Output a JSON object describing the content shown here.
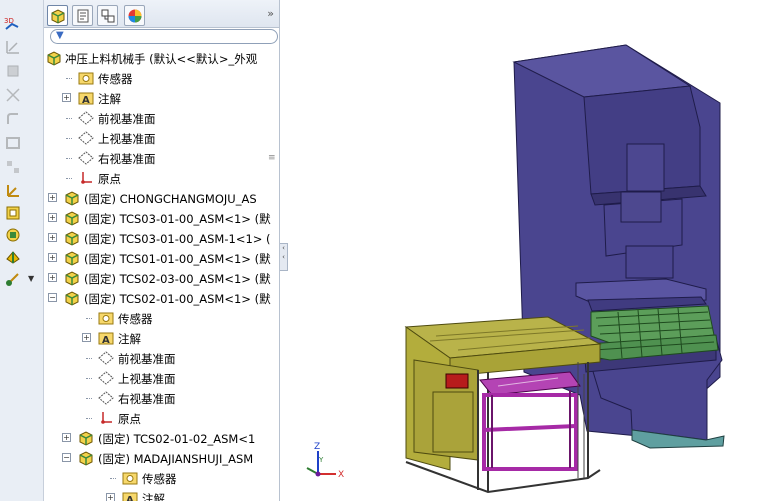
{
  "tree": {
    "root_label": "冲压上料机械手  (默认<<默认>_外观",
    "items": [
      {
        "label": "传感器",
        "icon": "sensor-folder-icon"
      },
      {
        "label": "注解",
        "icon": "annotation-folder-icon"
      },
      {
        "label": "前视基准面",
        "icon": "plane-icon"
      },
      {
        "label": "上视基准面",
        "icon": "plane-icon"
      },
      {
        "label": "右视基准面",
        "icon": "plane-icon"
      },
      {
        "label": "原点",
        "icon": "origin-icon"
      },
      {
        "label": "(固定) CHONGCHANGMOJU_AS",
        "icon": "assembly-icon"
      },
      {
        "label": "(固定) TCS03-01-00_ASM<1> (默",
        "icon": "assembly-icon"
      },
      {
        "label": "(固定) TCS03-01-00_ASM-1<1> (",
        "icon": "assembly-icon"
      },
      {
        "label": "(固定) TCS01-01-00_ASM<1> (默",
        "icon": "assembly-icon"
      },
      {
        "label": "(固定) TCS02-03-00_ASM<1> (默",
        "icon": "assembly-icon"
      },
      {
        "label": "(固定) TCS02-01-00_ASM<1> (默",
        "icon": "assembly-icon"
      },
      {
        "label": "传感器",
        "icon": "sensor-folder-icon"
      },
      {
        "label": "注解",
        "icon": "annotation-folder-icon"
      },
      {
        "label": "前视基准面",
        "icon": "plane-icon"
      },
      {
        "label": "上视基准面",
        "icon": "plane-icon"
      },
      {
        "label": "右视基准面",
        "icon": "plane-icon"
      },
      {
        "label": "原点",
        "icon": "origin-icon"
      },
      {
        "label": "(固定) TCS02-01-02_ASM<1",
        "icon": "assembly-icon"
      },
      {
        "label": "(固定) MADAJIANSHUJI_ASM",
        "icon": "assembly-icon"
      },
      {
        "label": "传感器",
        "icon": "sensor-folder-icon"
      },
      {
        "label": "注解",
        "icon": "annotation-folder-icon"
      }
    ],
    "more_glyph": "»"
  },
  "triad": {
    "x": "X",
    "y": "Y",
    "z": "Z"
  },
  "colors": {
    "press": "#4a458f",
    "press_edge": "#1f1c4a",
    "press_base_trim": "#5f9fa0",
    "die_green": "#5c9e5a",
    "conveyor_olive": "#b9b34a",
    "rack_magenta": "#a62aa6",
    "tree_bg": "#ffffff",
    "toolbar_bg": "#e9eef5"
  }
}
